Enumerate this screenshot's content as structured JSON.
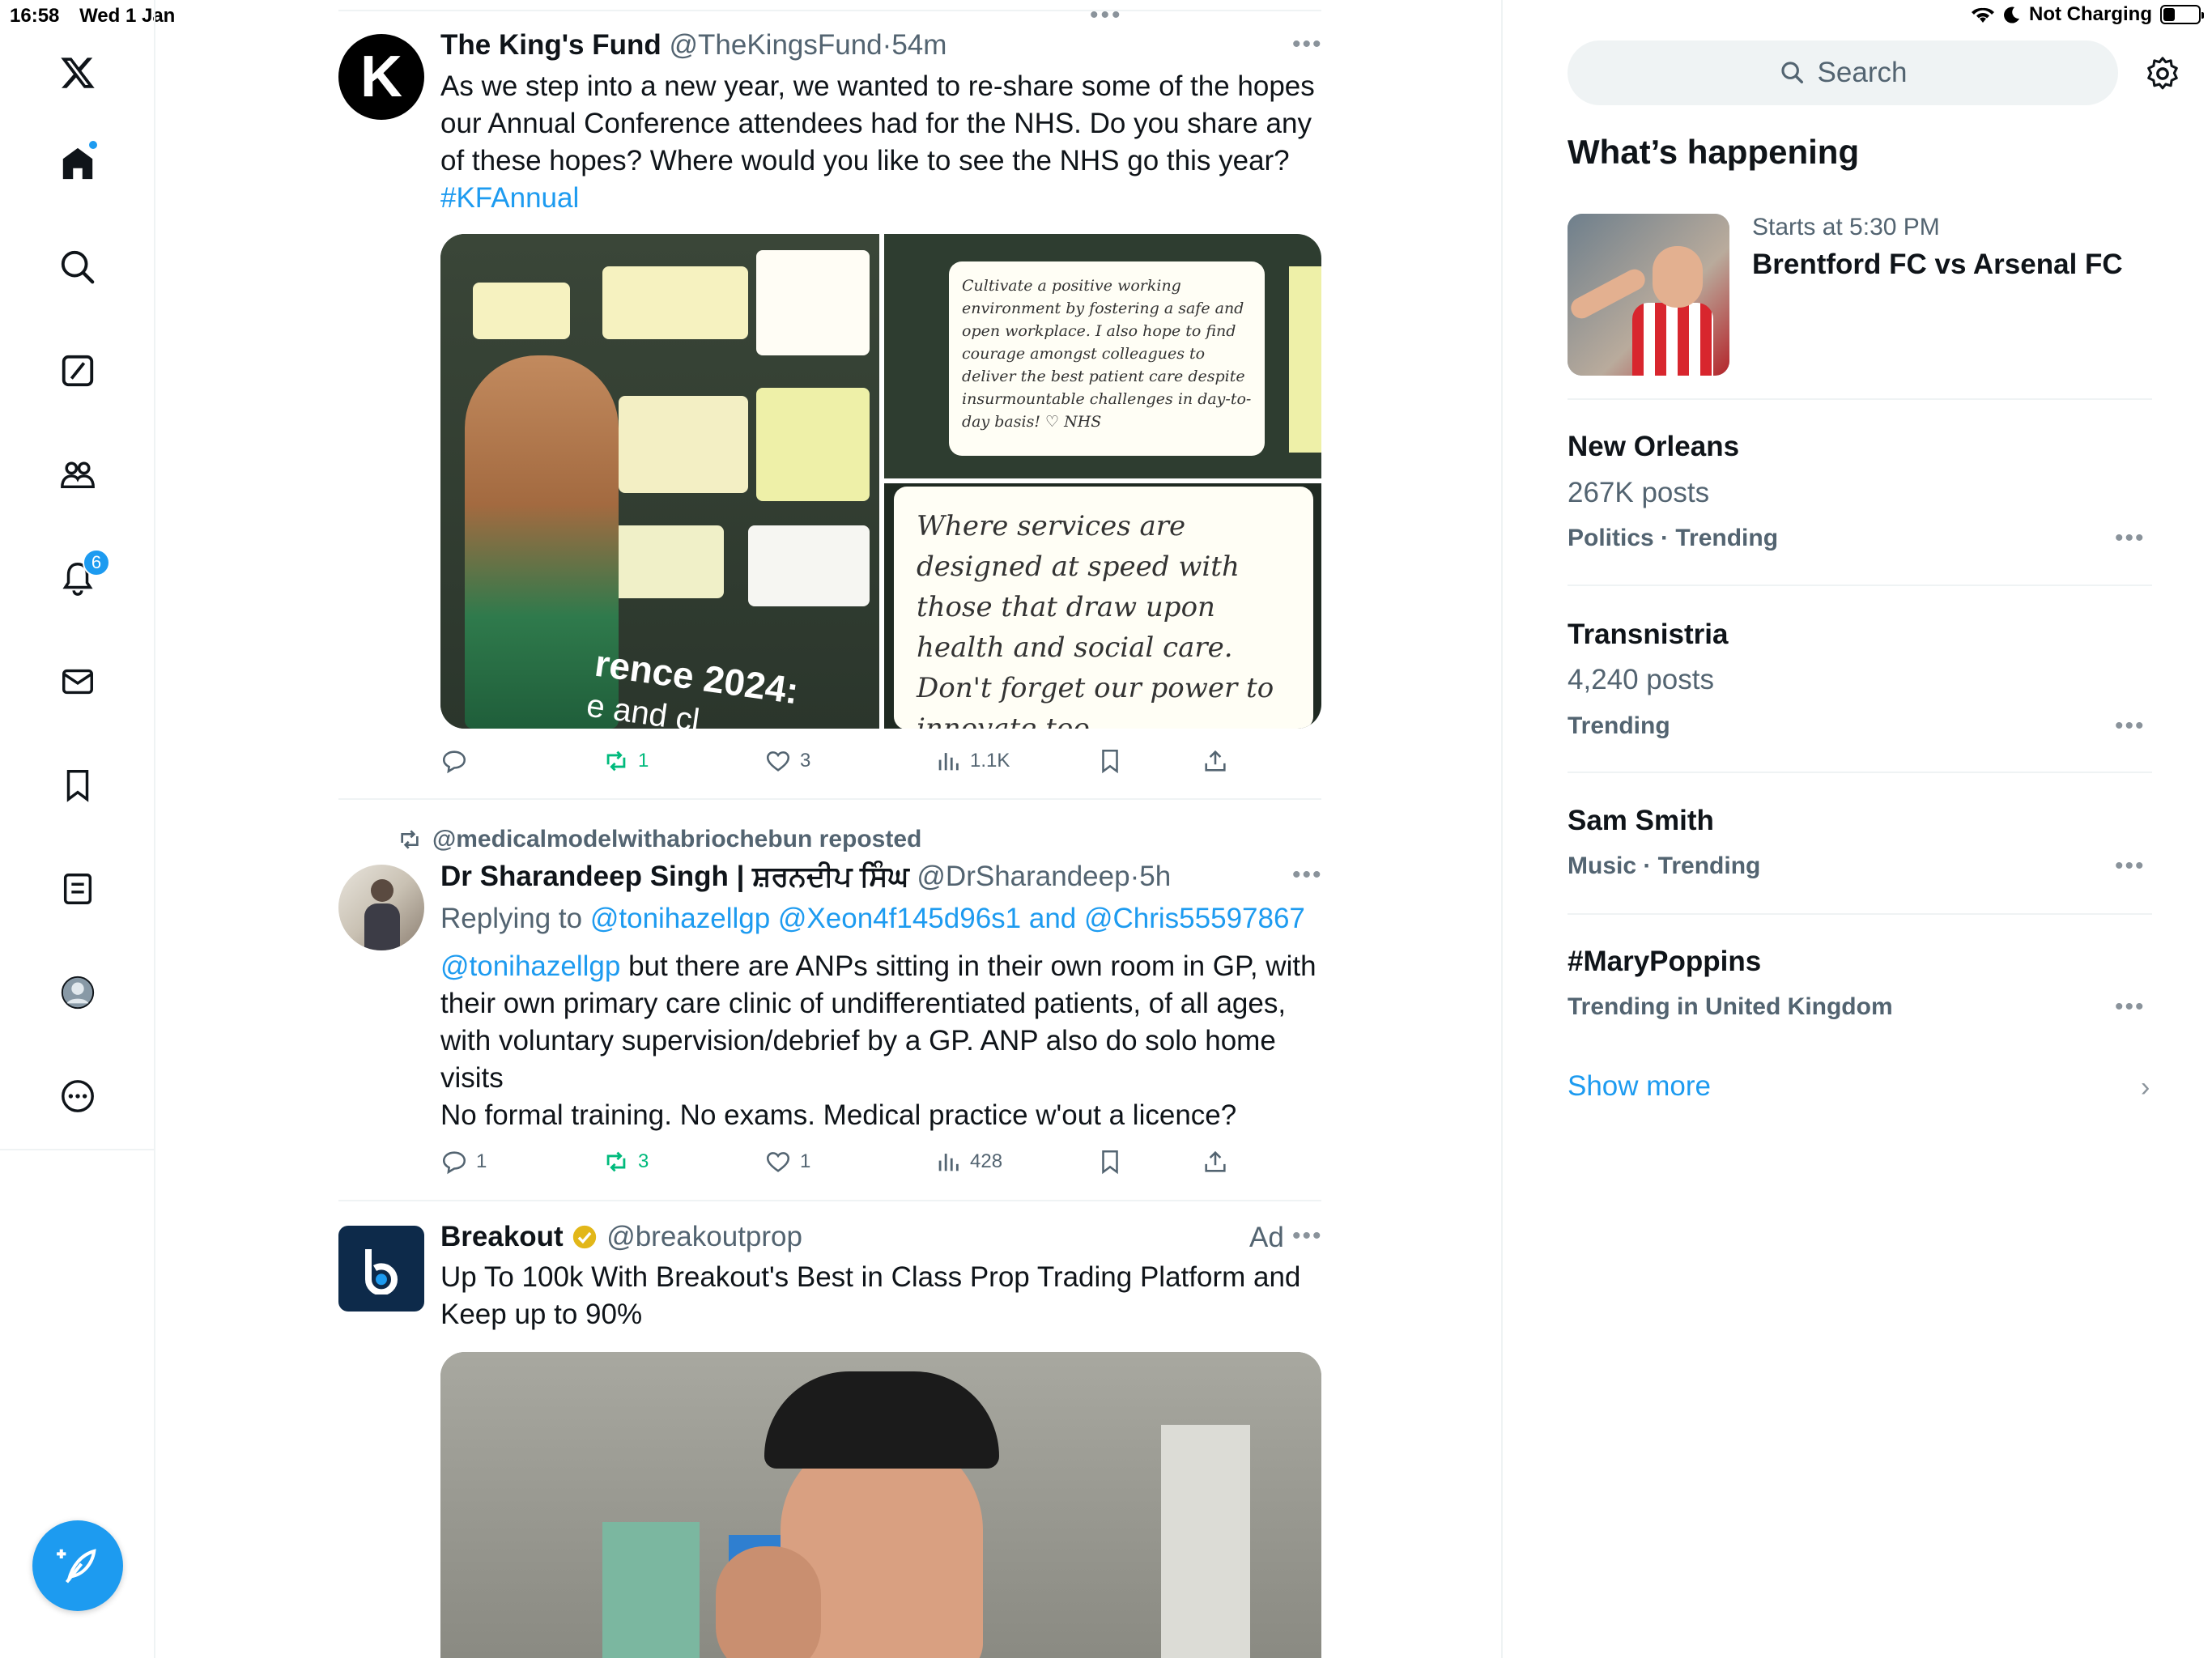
{
  "status_bar": {
    "time": "16:58",
    "date": "Wed 1 Jan",
    "charging": "Not Charging"
  },
  "nav": {
    "notifications_badge": "6",
    "items": [
      "home-icon",
      "search-icon",
      "grok-icon",
      "communities-icon",
      "notifications-icon",
      "messages-icon",
      "bookmarks-icon",
      "lists-icon",
      "profile-icon",
      "more-icon"
    ]
  },
  "tweets": [
    {
      "name": "The King's Fund",
      "handle": "@TheKingsFund",
      "time": "54m",
      "text": "As we step into a new year, we wanted to re-share some of the hopes our Annual Conference attendees had for the NHS. Do you share any of these hopes? Where would you like to see the NHS go this year?",
      "hashtag": "#KFAnnual",
      "notes": {
        "note1": "Cultivate a positive working environment by fostering a safe and open workplace. I also hope to find courage amongst colleagues to deliver the best patient care despite insurmountable challenges in day-to-day basis! ♡ NHS",
        "note2": "Where services are designed at speed with those that draw upon health and social care. Don't forget our power to innovate too.",
        "banner": "rence 2024:",
        "banner2": "e and cl"
      },
      "stats": {
        "replies": "",
        "reposts": "1",
        "likes": "3",
        "views": "1.1K"
      }
    },
    {
      "reposted_by": "@medicalmodelwithabriochebun reposted",
      "name": "Dr Sharandeep Singh | ਸ਼ਰਨਦੀਪ ਸਿੰਘ",
      "handle": "@DrSharandeep",
      "time": "5h",
      "replying_label": "Replying to",
      "replying_to": "@tonihazellgp @Xeon4f145d96s1 and @Chris55597867",
      "mention": "@tonihazellgp",
      "text_line1": " but there are ANPs sitting in their own room in GP, with their own primary care clinic of undifferentiated patients, of all ages, with voluntary supervision/debrief by a GP. ANP also do solo home visits",
      "text_line2": "No formal training. No exams. Medical practice w'out a licence?",
      "stats": {
        "replies": "1",
        "reposts": "3",
        "likes": "1",
        "views": "428"
      }
    },
    {
      "name": "Breakout",
      "handle": "@breakoutprop",
      "ad_label": "Ad",
      "text": "Up To 100k With Breakout's Best in Class Prop Trading Platform and Keep up to 90%"
    }
  ],
  "sidebar": {
    "search_placeholder": "Search",
    "whats_happening": "What’s happening",
    "event": {
      "time": "Starts at 5:30 PM",
      "title": "Brentford FC vs Arsenal FC"
    },
    "trends": [
      {
        "name": "New Orleans",
        "posts": "267K posts",
        "category": "Politics · Trending"
      },
      {
        "name": "Transnistria",
        "posts": "4,240 posts",
        "category": "Trending"
      },
      {
        "name": "Sam Smith",
        "posts": "",
        "category": "Music · Trending"
      },
      {
        "name": "#MaryPoppins",
        "posts": "",
        "category": "Trending in United Kingdom"
      }
    ],
    "show_more": "Show more"
  },
  "colors": {
    "accent": "#1d9bf0",
    "repost_green": "#00ba7c",
    "muted": "#536471",
    "text": "#0f1419"
  }
}
